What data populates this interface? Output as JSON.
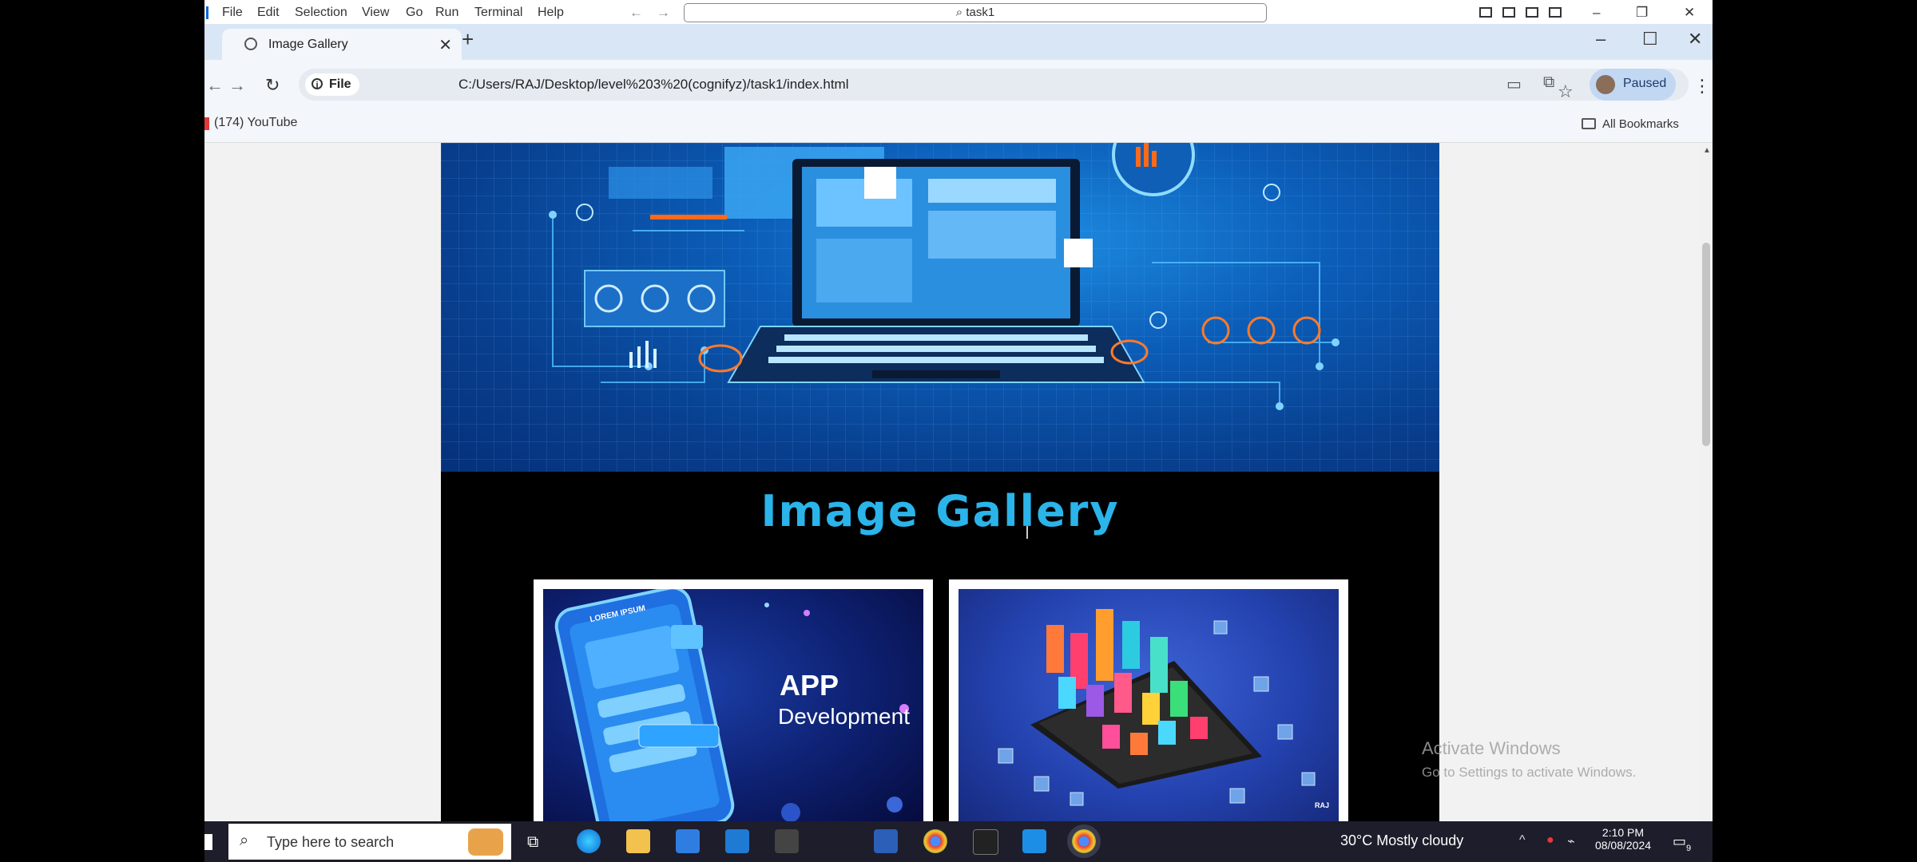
{
  "vscode": {
    "menu": [
      "File",
      "Edit",
      "Selection",
      "View",
      "Go",
      "Run",
      "Terminal",
      "Help"
    ],
    "command_center": "task1"
  },
  "browser": {
    "tab_title": "Image Gallery",
    "address_chip": "File",
    "url": "C:/Users/RAJ/Desktop/level%203%20(cognifyz)/task1/index.html",
    "profile_status": "Paused",
    "bookmark_youtube": "(174) YouTube",
    "all_bookmarks": "All Bookmarks"
  },
  "page": {
    "heading": "Image Gallery",
    "card1": {
      "line1": "APP",
      "line2": "Development",
      "badge": "LOREM IPSUM"
    },
    "card2": {
      "brand": "RAJ"
    }
  },
  "watermark": {
    "title": "Activate Windows",
    "subtitle": "Go to Settings to activate Windows."
  },
  "taskbar": {
    "search_placeholder": "Type here to search",
    "weather": "30°C  Mostly cloudy",
    "time": "2:10 PM",
    "date": "08/08/2024",
    "notification_count": "9"
  },
  "colors": {
    "heading": "#2ab4ea",
    "tabstrip": "#d9e6f6",
    "taskbar": "#1d1d2b"
  }
}
